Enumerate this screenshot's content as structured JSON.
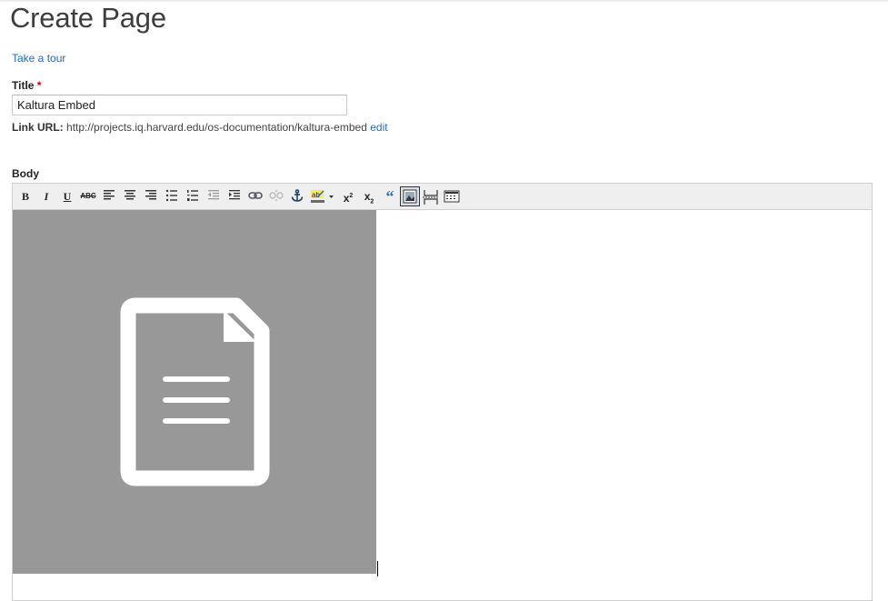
{
  "page": {
    "title": "Create Page",
    "tour_link": "Take a tour"
  },
  "form": {
    "title_label": "Title",
    "required_mark": "*",
    "title_value": "Kaltura Embed",
    "link_url_label": "Link URL:",
    "link_url_value": "http://projects.iq.harvard.edu/os-documentation/kaltura-embed",
    "link_url_edit": "edit",
    "body_label": "Body"
  },
  "toolbar": {
    "bold": "B",
    "italic": "I",
    "underline": "U",
    "strikethrough": "ABC",
    "superscript": "x",
    "superscript_mark": "2",
    "subscript": "x",
    "subscript_mark": "2",
    "blockquote": "“"
  },
  "colors": {
    "link": "#2a6bb5",
    "placeholder_bg": "#989898",
    "toolbar_bg": "#efefef",
    "required": "#d00000"
  },
  "icons": [
    "align-left-icon",
    "align-center-icon",
    "align-right-icon",
    "bullet-list-icon",
    "numbered-list-icon",
    "outdent-icon",
    "indent-icon",
    "link-icon",
    "unlink-icon",
    "anchor-icon",
    "highlight-icon",
    "image-icon",
    "page-break-icon",
    "table-icon",
    "document-icon"
  ]
}
